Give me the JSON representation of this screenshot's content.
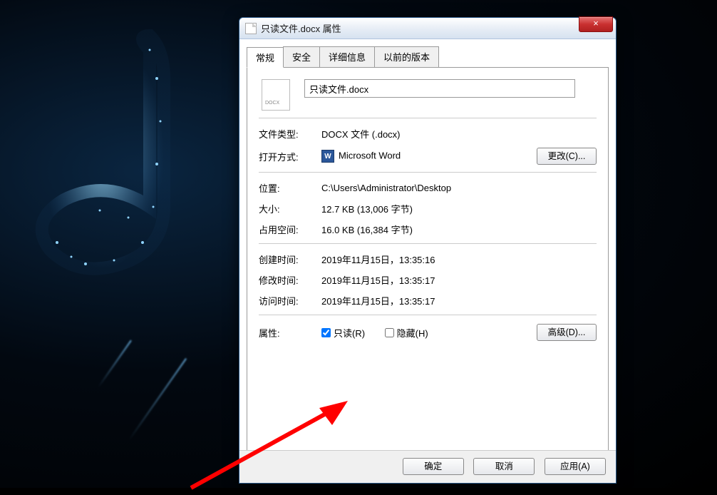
{
  "window": {
    "title": "只读文件.docx 属性",
    "close_glyph": "×"
  },
  "tabs": {
    "general": "常规",
    "security": "安全",
    "details": "详细信息",
    "previous": "以前的版本"
  },
  "filename": "只读文件.docx",
  "fields": {
    "filetype_label": "文件类型:",
    "filetype_value": "DOCX 文件 (.docx)",
    "openwith_label": "打开方式:",
    "openwith_value": "Microsoft Word",
    "change_btn": "更改(C)...",
    "location_label": "位置:",
    "location_value": "C:\\Users\\Administrator\\Desktop",
    "size_label": "大小:",
    "size_value": "12.7 KB (13,006 字节)",
    "sizeondisk_label": "占用空间:",
    "sizeondisk_value": "16.0 KB (16,384 字节)",
    "created_label": "创建时间:",
    "created_value": "2019年11月15日，13:35:16",
    "modified_label": "修改时间:",
    "modified_value": "2019年11月15日，13:35:17",
    "accessed_label": "访问时间:",
    "accessed_value": "2019年11月15日，13:35:17",
    "attributes_label": "属性:",
    "readonly_label": "只读(R)",
    "hidden_label": "隐藏(H)",
    "advanced_btn": "高级(D)..."
  },
  "footer": {
    "ok": "确定",
    "cancel": "取消",
    "apply": "应用(A)"
  }
}
